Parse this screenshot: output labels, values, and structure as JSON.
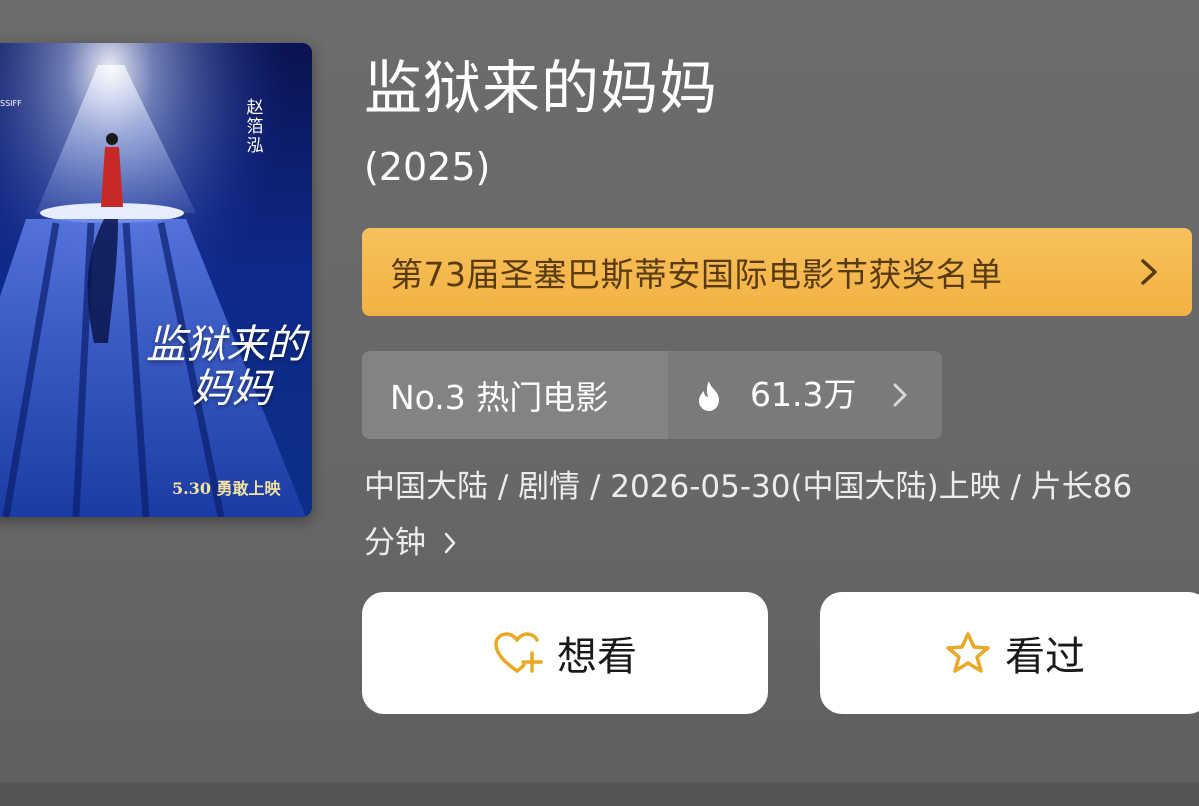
{
  "poster": {
    "title_line1": "监狱来的",
    "title_line2": "妈妈",
    "release_note": "5.30 勇敢上映",
    "director": "赵箔泓",
    "festival_logo": "SSIFF"
  },
  "movie": {
    "title": "监狱来的妈妈",
    "year": "(2025)"
  },
  "award_banner": {
    "label": "第73届圣塞巴斯蒂安国际电影节获奖名单",
    "icon": "chevron-right-icon"
  },
  "ranking": {
    "rank_label": "No.3 热门电影",
    "heat_icon": "fire-icon",
    "heat_value": "61.3万",
    "icon": "chevron-right-icon"
  },
  "meta": {
    "line1": "中国大陆 / 剧情 / 2026-05-30(中国大陆)上映 / 片长86",
    "line2": "分钟"
  },
  "actions": {
    "want_label": "想看",
    "want_icon": "heart-plus-icon",
    "seen_label": "看过",
    "seen_icon": "star-icon"
  },
  "colors": {
    "background": "#6a6a6a",
    "award_bg": "#f4b84a",
    "award_text": "#5a3c0c",
    "icon_gold": "#e9a825",
    "button_bg": "#ffffff"
  }
}
